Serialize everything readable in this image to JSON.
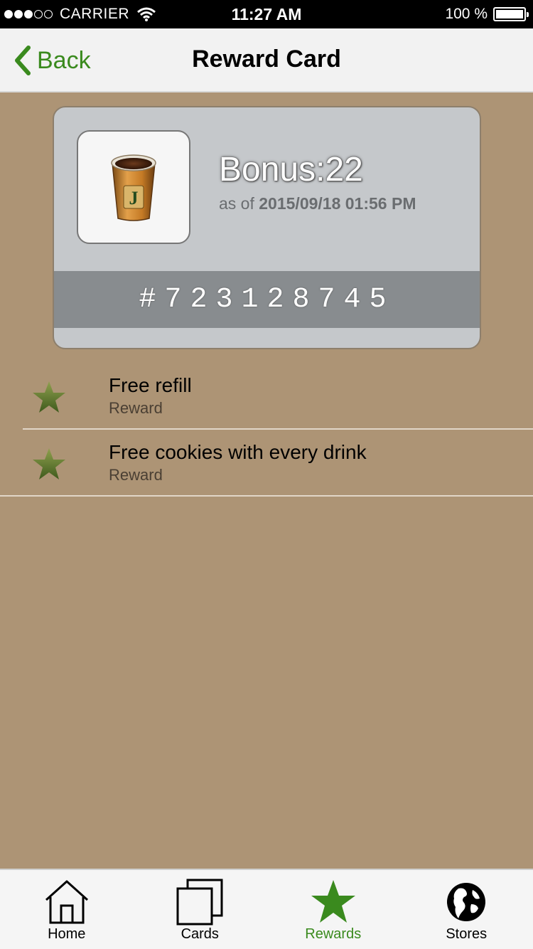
{
  "status_bar": {
    "carrier": "CARRIER",
    "time": "11:27 AM",
    "battery": "100 %",
    "signal_bars_filled": 3,
    "signal_bars_total": 5
  },
  "nav": {
    "back_label": "Back",
    "title": "Reward Card"
  },
  "card": {
    "bonus": "Bonus:22",
    "as_of_prefix": "as of",
    "as_of_date": "2015/09/18 01:56 PM",
    "number": "#723128745",
    "logo_letter": "J"
  },
  "rewards": [
    {
      "title": "Free refill",
      "subtitle": "Reward"
    },
    {
      "title": "Free cookies with every drink",
      "subtitle": "Reward"
    }
  ],
  "tabs": [
    {
      "label": "Home",
      "icon": "home-icon",
      "active": false
    },
    {
      "label": "Cards",
      "icon": "cards-icon",
      "active": false
    },
    {
      "label": "Rewards",
      "icon": "star-icon",
      "active": true
    },
    {
      "label": "Stores",
      "icon": "globe-icon",
      "active": false
    }
  ],
  "colors": {
    "accent": "#3a8a1e",
    "background": "#ad9475",
    "card": "#c5c8cb",
    "card_strip": "#888c8f"
  }
}
